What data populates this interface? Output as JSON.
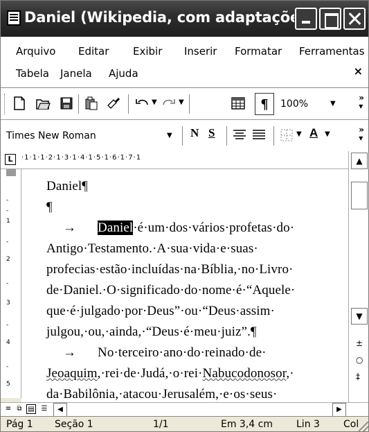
{
  "window": {
    "title": "Daniel (Wikipedia, com adaptações) - M..."
  },
  "menu": {
    "items": [
      "Arquivo",
      "Editar",
      "Exibir",
      "Inserir",
      "Formatar",
      "Ferramentas",
      "Tabela",
      "Janela",
      "Ajuda"
    ],
    "close_symbol": "×"
  },
  "toolbar_standard": {
    "zoom": "100%",
    "pilcrow": "¶"
  },
  "toolbar_format": {
    "font": "Times New Roman",
    "bold": "N",
    "underline": "S",
    "font_color_letter": "A"
  },
  "ruler": {
    "text": "·1·1·1·2·1·3·1·4·1·5·1·6·1·7·1"
  },
  "document": {
    "lines": [
      "Daniel¶",
      "¶",
      "→",
      "Daniel",
      "·é·um·dos·vários·profetas·do·",
      "Antigo·Testamento.·A·sua·vida·e·suas·",
      "profecias·estão·incluídas·na·Bíblia,·no·Livro·",
      "de·Daniel.·O·significado·do·nome·é·“Aquele·",
      "que·é·julgado·por·Deus”·ou·“Deus·assim·",
      "julgou,·ou,·ainda,·“Deus·é·meu·juiz”.¶",
      "→",
      "No·terceiro·ano·do·reinado·de·",
      "Jeoaquim",
      ",·rei·de·Judá,·o·rei·",
      "Nabucodonosor",
      ",·",
      "da·Babilônia,·atacou·Jerusalém,·e·os·seus·"
    ]
  },
  "status": {
    "page": "Pág 1",
    "section": "Seção 1",
    "pages": "1/1",
    "position": "Em 3,4 cm",
    "line": "Lin 3",
    "col": "Col"
  }
}
